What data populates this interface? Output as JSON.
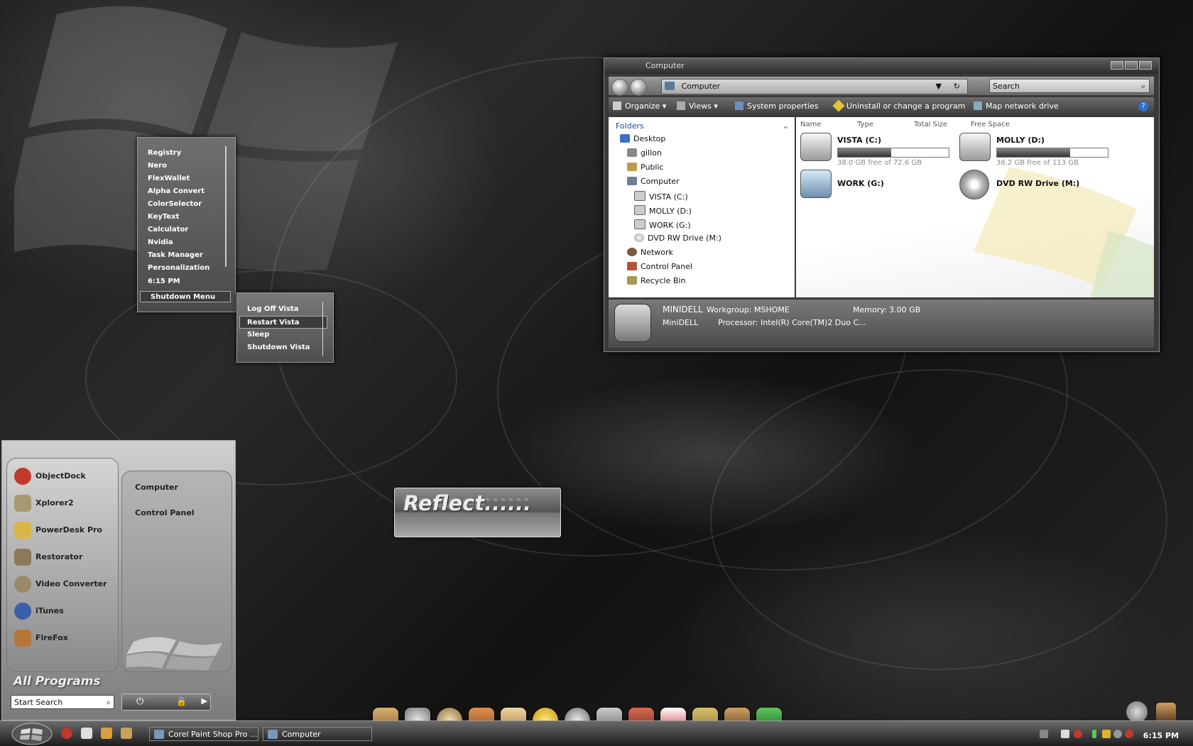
{
  "launcher": {
    "items": [
      "Registry",
      "Nero",
      "FlexWallet",
      "Alpha Convert",
      "ColorSelector",
      "KeyText",
      "Calculator",
      "Nvidia",
      "Task Manager",
      "Personalization"
    ],
    "time": "6:15 PM",
    "shutdown": "Shutdown Menu"
  },
  "shutdown_menu": {
    "items": [
      "Log Off Vista",
      "Restart Vista",
      "Sleep",
      "Shutdown Vista"
    ]
  },
  "explorer": {
    "title": "Computer",
    "address": "Computer",
    "search_placeholder": "Search",
    "toolbar": {
      "organize": "Organize",
      "views": "Views",
      "system_properties": "System properties",
      "uninstall": "Uninstall or change a program",
      "map_drive": "Map network drive"
    },
    "folders_label": "Folders",
    "tree": {
      "desktop": "Desktop",
      "gillon": "gillon",
      "public": "Public",
      "computer": "Computer",
      "vista": "VISTA (C:)",
      "molly": "MOLLY (D:)",
      "work": "WORK (G:)",
      "dvd": "DVD RW Drive (M:)",
      "network": "Network",
      "control_panel": "Control Panel",
      "recycle_bin": "Recycle Bin"
    },
    "columns": {
      "name": "Name",
      "type": "Type",
      "total": "Total Size",
      "free": "Free Space"
    },
    "drives": {
      "vista": {
        "name": "VISTA (C:)",
        "free": "38.0 GB free of 72.6 GB",
        "used_fraction": 0.48
      },
      "molly": {
        "name": "MOLLY (D:)",
        "free": "38.2 GB free of 113 GB",
        "used_fraction": 0.66
      },
      "work": {
        "name": "WORK (G:)"
      },
      "dvd": {
        "name": "DVD RW Drive (M:)"
      }
    },
    "details": {
      "computer_name": "MINIDELL",
      "workgroup": "Workgroup: MSHOME",
      "memory": "Memory: 3.00 GB",
      "name2": "MiniDELL",
      "processor": "Processor: Intel(R) Core(TM)2 Duo C..."
    }
  },
  "start_menu": {
    "pinned": [
      "ObjectDock",
      "Xplorer2",
      "PowerDesk Pro",
      "Restorator",
      "Video Converter",
      "iTunes",
      "FireFox"
    ],
    "places": [
      "Computer",
      "Control Panel"
    ],
    "all_programs": "All Programs",
    "search_placeholder": "Start Search"
  },
  "widget": {
    "text": "Reflect......"
  },
  "taskbar": {
    "tasks": [
      "Corel Paint Shop Pro ...",
      "Computer"
    ],
    "clock": "6:15 PM"
  }
}
